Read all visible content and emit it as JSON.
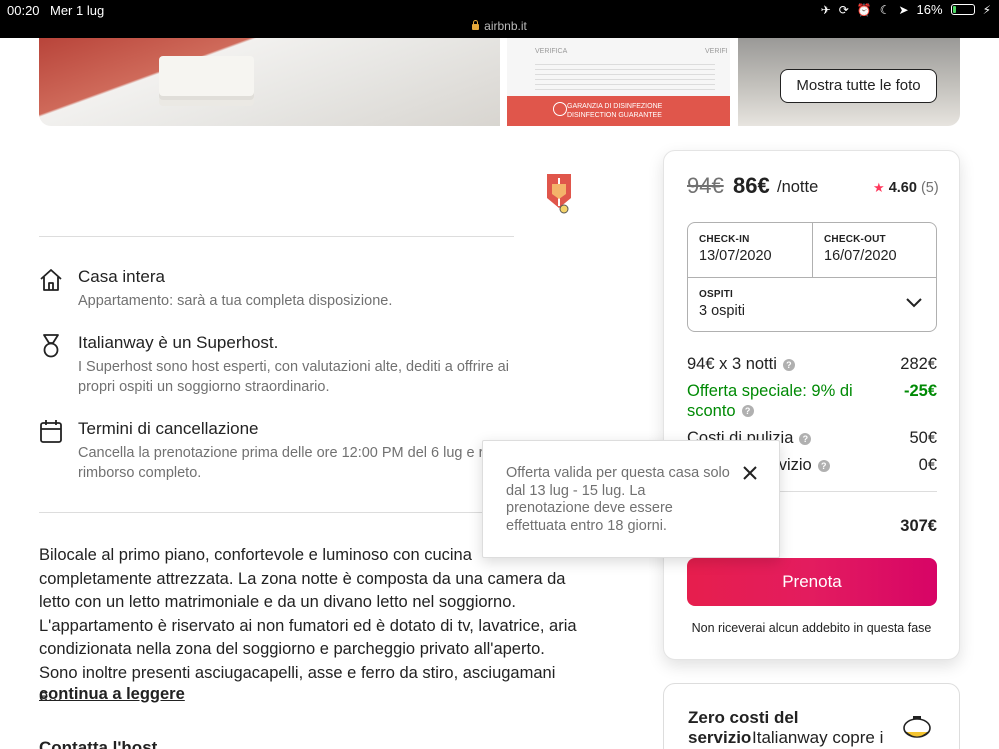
{
  "status_bar": {
    "time": "00:20",
    "date": "Mer 1 lug",
    "url": "airbnb.it",
    "battery": "16%",
    "battery_level": 0.16
  },
  "photos": {
    "show_all_label": "Mostra tutte le foto",
    "photo2_heading": "VERIFICA",
    "photo2_heading2": "VERIFI",
    "photo2_banner_line1": "GARANZIA DI DISINFEZIONE",
    "photo2_banner_line2": "DISINFECTION GUARANTEE"
  },
  "features": [
    {
      "title": "Casa intera",
      "description": "Appartamento: sarà a tua completa disposizione."
    },
    {
      "title": "Italianway è un Superhost.",
      "description": "I Superhost sono host esperti, con valutazioni alte, dediti a offrire ai propri ospiti un soggiorno straordinario."
    },
    {
      "title": "Termini di cancellazione",
      "description": "Cancella la prenotazione prima delle ore 12:00 PM del 6 lug e ricevi un rimborso completo."
    }
  ],
  "description": {
    "text": "Bilocale al primo piano, confortevole e luminoso con cucina completamente attrezzata. La zona notte è composta da una camera da letto con un letto matrimoniale e da un divano letto nel soggiorno. L'appartamento è riservato ai non fumatori ed è dotato di tv, lavatrice, aria condizionata nella zona del soggiorno e parcheggio privato all'aperto. Sono inoltre presenti asciugacapelli, asse e ferro da stiro, asciugamani e...",
    "read_more": "continua a leggere",
    "contact_heading": "Contatta l'host"
  },
  "booking": {
    "old_price": "94€",
    "price": "86€",
    "per_night": "/notte",
    "rating": "4.60",
    "review_count": "(5)",
    "checkin_label": "CHECK-IN",
    "checkin_value": "13/07/2020",
    "checkout_label": "CHECK-OUT",
    "checkout_value": "16/07/2020",
    "guests_label": "OSPITI",
    "guests_value": "3 ospiti",
    "nights_label": "94€ x 3 notti",
    "nights_amount": "282€",
    "offer_label_1": "Offerta speciale: 9% di",
    "offer_label_2": "sconto",
    "offer_amount": "-25€",
    "cleaning_label": "Costi di pulizia",
    "cleaning_amount": "50€",
    "service_label": "Costi del servizio",
    "service_amount": "0€",
    "total_amount": "307€",
    "book_label": "Prenota",
    "no_charge": "Non riceverai alcun addebito in questa fase",
    "accent_color": "#e31c5f"
  },
  "promo_card": {
    "title": "Zero costi del servizio",
    "text": "Italianway copre i"
  },
  "tooltip": {
    "text": "Offerta valida per questa casa solo dal 13 lug - 15 lug. La prenotazione deve essere effettuata entro 18 giorni."
  }
}
